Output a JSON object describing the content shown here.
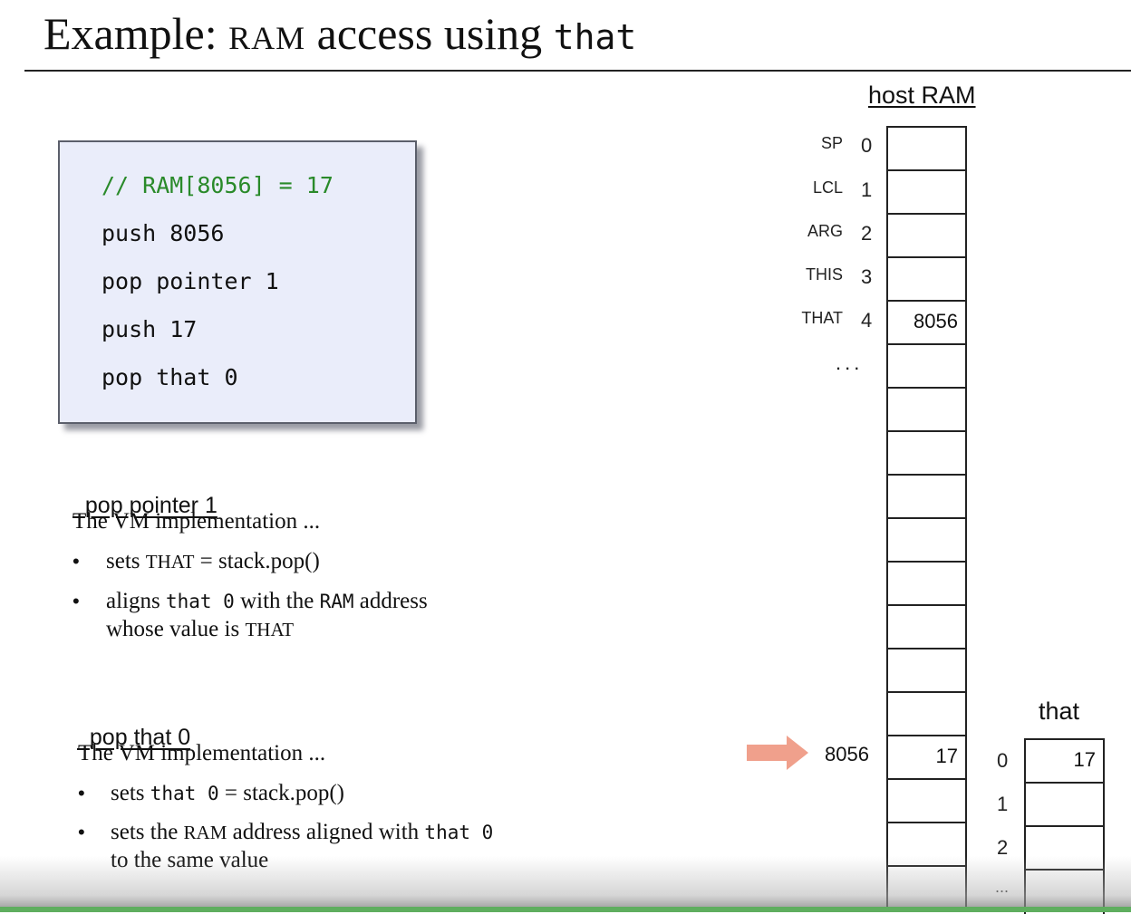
{
  "title": {
    "prefix": "Example:",
    "ram": "RAM",
    "middle": "access using",
    "code": "that"
  },
  "code_box": {
    "lines": [
      "// RAM[8056] = 17",
      "push 8056",
      "pop pointer 1",
      "push 17",
      "pop that 0"
    ]
  },
  "section1": {
    "heading": "pop pointer 1",
    "intro": "The VM implementation ...",
    "b1_a": "sets",
    "b1_code": "THAT",
    "b1_b": " = stack.pop()",
    "b2_a": "aligns",
    "b2_code1": "that 0",
    "b2_b": "with the",
    "b2_code2": "RAM",
    "b2_c": "address",
    "b2_line2": "whose value is",
    "b2_code3": "THAT"
  },
  "section2": {
    "heading": "pop that 0",
    "intro": "The VM implementation ...",
    "b1_code": "that 0",
    "b1_a": "sets",
    "b1_b": " = stack.pop()",
    "b2_a": "sets the",
    "b2_code1": "RAM",
    "b2_b": "address aligned with",
    "b2_code2": "that 0",
    "b2_line2": "to the same value"
  },
  "memory": {
    "host_label": "host RAM",
    "registers": [
      {
        "name": "SP",
        "index": "0",
        "value": ""
      },
      {
        "name": "LCL",
        "index": "1",
        "value": ""
      },
      {
        "name": "ARG",
        "index": "2",
        "value": ""
      },
      {
        "name": "THIS",
        "index": "3",
        "value": ""
      },
      {
        "name": "THAT",
        "index": "4",
        "value": "8056"
      }
    ],
    "ellipsis": "...",
    "address_label": "8056",
    "address_value": "17",
    "that_label": "that",
    "that_segment": [
      {
        "index": "0",
        "value": "17"
      },
      {
        "index": "1",
        "value": ""
      },
      {
        "index": "2",
        "value": ""
      },
      {
        "index": "...",
        "value": ""
      }
    ],
    "arrow_color": "#f0a08c"
  }
}
